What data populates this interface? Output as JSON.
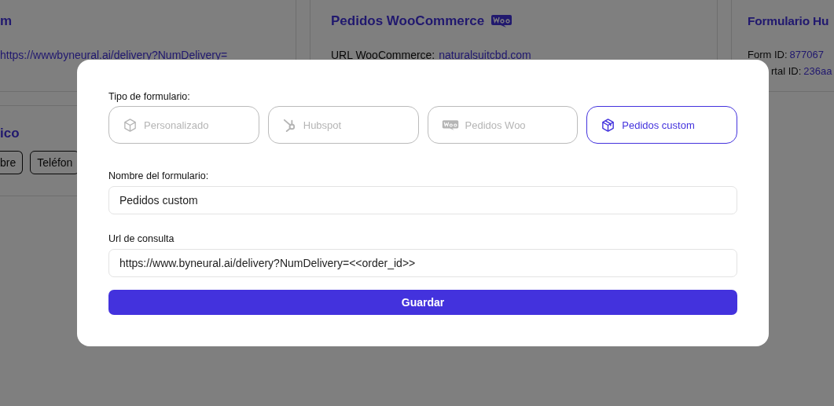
{
  "cards": [
    {
      "title": "m",
      "fields": [
        {
          "value": "https://wwwbyneural.ai/delivery?NumDelivery="
        }
      ]
    },
    {
      "title": "Pedidos WooCommerce",
      "kind": "woo",
      "fields": [
        {
          "label": "URL WooCommerce:",
          "value": "naturalsuitcbd.com"
        }
      ]
    },
    {
      "title": "Formulario Hu",
      "fields": [
        {
          "label": "Form ID:",
          "value": "877067"
        },
        {
          "label": "rtal ID:",
          "value": "236aa"
        }
      ]
    }
  ],
  "lower_card": {
    "title": "ico",
    "chips": [
      "bre",
      "Teléfon"
    ]
  },
  "modal": {
    "type_label": "Tipo de formulario:",
    "types": [
      {
        "label": "Personalizado",
        "kind": "cube",
        "selected": false
      },
      {
        "label": "Hubspot",
        "kind": "hubspot",
        "selected": false
      },
      {
        "label": "Pedidos Woo",
        "kind": "woo",
        "selected": false
      },
      {
        "label": "Pedidos custom",
        "kind": "package",
        "selected": true
      }
    ],
    "fields": [
      {
        "label": "Nombre del formulario:",
        "value": "Pedidos custom"
      },
      {
        "label": "Url de consulta",
        "value": "https://www.byneural.ai/delivery?NumDelivery=<<order_id>>"
      }
    ],
    "submit": "Guardar"
  }
}
